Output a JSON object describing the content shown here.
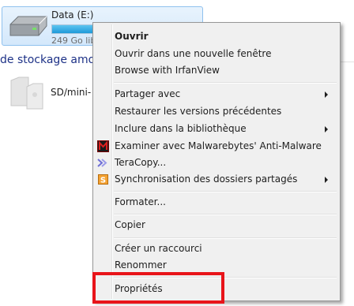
{
  "drive": {
    "title": "Data (E:)",
    "free_text": "249 Go lib",
    "used_fraction": 0.8
  },
  "section_heading": "de stockage amo",
  "sd_device": {
    "label": "SD/mini-"
  },
  "context_menu": {
    "items": [
      {
        "label": "Ouvrir",
        "bold": true
      },
      {
        "label": "Ouvrir dans une nouvelle fenêtre"
      },
      {
        "label": "Browse with IrfanView"
      },
      {
        "label": "Partager avec",
        "submenu": true
      },
      {
        "label": "Restaurer les versions précédentes"
      },
      {
        "label": "Inclure dans la bibliothèque",
        "submenu": true
      },
      {
        "label": "Examiner avec Malwarebytes' Anti-Malware",
        "icon": "malwarebytes-icon"
      },
      {
        "label": "TeraCopy...",
        "icon": "teracopy-icon"
      },
      {
        "label": "Synchronisation des dossiers partagés",
        "icon": "sync-folders-icon",
        "submenu": true
      },
      {
        "label": "Formater..."
      },
      {
        "label": "Copier"
      },
      {
        "label": "Créer un raccourci"
      },
      {
        "label": "Renommer"
      },
      {
        "label": "Propriétés"
      }
    ]
  },
  "colors": {
    "highlight": "#e8141a",
    "section_heading": "#1e3287",
    "drive_bar": "#1e9ad9"
  }
}
